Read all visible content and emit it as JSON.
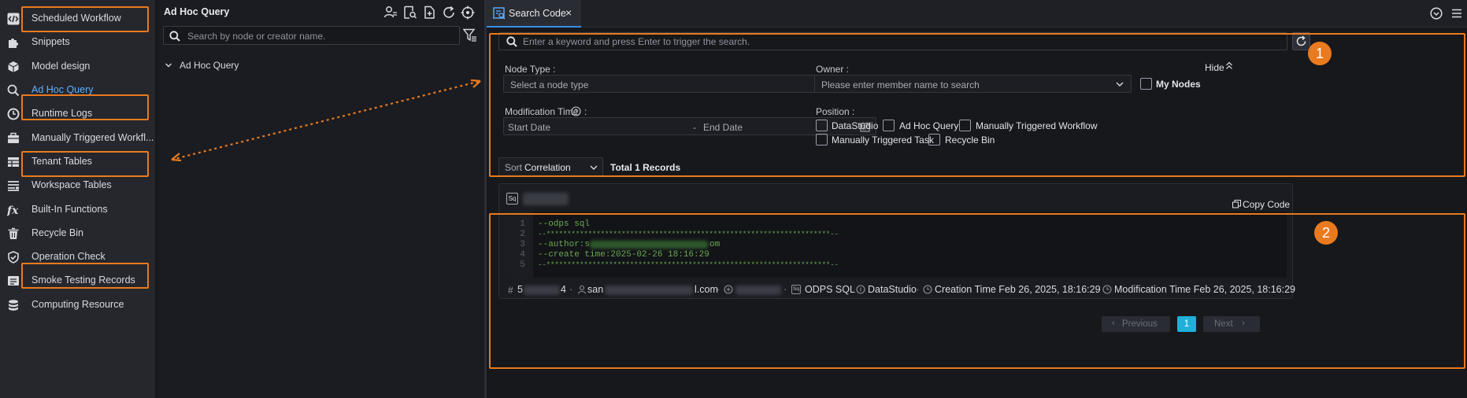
{
  "sidebar": {
    "items": [
      {
        "label": "Scheduled Workflow",
        "icon": "code-icon"
      },
      {
        "label": "Snippets",
        "icon": "puzzle-icon"
      },
      {
        "label": "Model design",
        "icon": "cube-icon"
      },
      {
        "label": "Ad Hoc Query",
        "icon": "search-icon"
      },
      {
        "label": "Runtime Logs",
        "icon": "clock-icon"
      },
      {
        "label": "Manually Triggered Workfl...",
        "icon": "briefcase-icon"
      },
      {
        "label": "Tenant Tables",
        "icon": "table-icon"
      },
      {
        "label": "Workspace Tables",
        "icon": "list-table-icon"
      },
      {
        "label": "Built-In Functions",
        "icon": "fx-icon"
      },
      {
        "label": "Recycle Bin",
        "icon": "trash-icon"
      },
      {
        "label": "Operation Check",
        "icon": "shield-check-icon"
      },
      {
        "label": "Smoke Testing Records",
        "icon": "records-icon"
      },
      {
        "label": "Computing Resource",
        "icon": "database-icon"
      }
    ],
    "active_index": 3
  },
  "middle": {
    "title": "Ad Hoc Query",
    "search_placeholder": "Search by node or creator name.",
    "tree_root": "Ad Hoc Query"
  },
  "tabs": [
    {
      "label": "Search Code",
      "close": "×"
    }
  ],
  "search": {
    "placeholder": "Enter a keyword and press Enter to trigger the search.",
    "node_type_label": "Node Type :",
    "node_type_placeholder": "Select a node type",
    "owner_label": "Owner :",
    "owner_placeholder": "Please enter member name to search",
    "my_nodes": "My Nodes",
    "hide": "Hide",
    "mod_time_label": "Modification Time",
    "mod_time_colon": ":",
    "start_date": "Start Date",
    "date_sep": "-",
    "end_date": "End Date",
    "position_label": "Position :",
    "positions": [
      "DataStudio",
      "Ad Hoc Query",
      "Manually Triggered Workflow",
      "Manually Triggered Task",
      "Recycle Bin"
    ]
  },
  "sort": {
    "label": "Sort",
    "value": "Correlation",
    "total": "Total 1 Records"
  },
  "result": {
    "type_badge": "Sq",
    "copy_code": "Copy Code",
    "code_lines": [
      "--odps sql",
      "--********************************************************************--",
      "--author:s",
      "--create time:2025-02-26 18:16:29",
      "--********************************************************************--"
    ],
    "line_numbers": [
      "1",
      "2",
      "3",
      "4",
      "5"
    ],
    "author_suffix": "om",
    "meta": {
      "id_prefix": "5",
      "id_suffix": "4",
      "owner_prefix": "san",
      "owner_suffix": "l.com",
      "sep": "·",
      "type_badge": "Sq",
      "node_type": "ODPS SQL",
      "position": "DataStudio",
      "creation_time": "Creation Time Feb 26, 2025, 18:16:29",
      "modification_time": "Modification Time Feb 26, 2025, 18:16:29"
    }
  },
  "pagination": {
    "previous": "Previous",
    "current": "1",
    "next": "Next"
  },
  "annotations": {
    "badge1": "1",
    "badge2": "2"
  },
  "colors": {
    "highlight": "#e97a1e",
    "accent": "#3a8ee6",
    "active_text": "#5fb0ff",
    "code_green": "#6aa84f"
  }
}
